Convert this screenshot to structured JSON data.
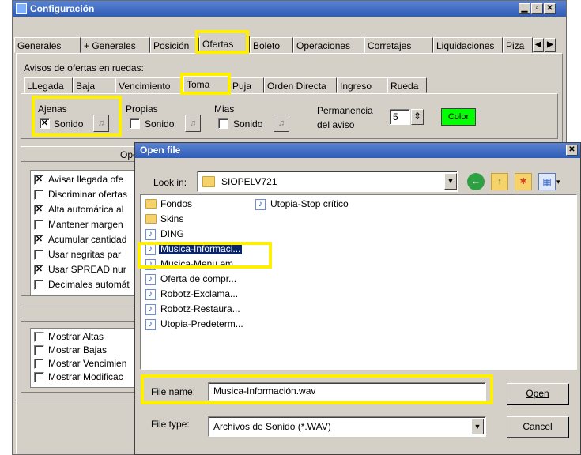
{
  "main": {
    "title": "Configuración",
    "tabs": [
      "Generales",
      "+ Generales",
      "Posición",
      "Ofertas",
      "Boleto",
      "Operaciones",
      "Corretajes",
      "Liquidaciones",
      "Piza"
    ],
    "avisos_label": "Avisos de ofertas en ruedas:",
    "subtabs": [
      "LLegada",
      "Baja",
      "Vencimiento",
      "Toma",
      "Puja",
      "Orden Directa",
      "Ingreso",
      "Rueda"
    ],
    "ajenas_label": "Ajenas",
    "propias_label": "Propias",
    "mias_label": "Mias",
    "sonido_label": "Sonido",
    "permanencia_label_1": "Permanencia",
    "permanencia_label_2": "del aviso",
    "permanencia_value": "5",
    "color_label": "Color",
    "options_header": "Opc",
    "options": [
      {
        "label": "Avisar llegada ofe",
        "checked": true
      },
      {
        "label": "Discriminar ofertas",
        "checked": false
      },
      {
        "label": "Alta automática al",
        "checked": true
      },
      {
        "label": "Mantener margen",
        "checked": false
      },
      {
        "label": "Acumular cantidad",
        "checked": true
      },
      {
        "label": "Usar negritas par",
        "checked": false
      },
      {
        "label": "Usar SPREAD nur",
        "checked": true
      },
      {
        "label": "Decimales automát",
        "checked": false
      }
    ],
    "mostrar": [
      "Mostrar Altas",
      "Mostrar Bajas",
      "Mostrar Vencimien",
      "Mostrar Modificac"
    ]
  },
  "dialog": {
    "title": "Open file",
    "look_in_label": "Look in:",
    "look_in_value": "SIOPELV721",
    "files_col1": [
      {
        "name": "Fondos",
        "type": "folder"
      },
      {
        "name": "Skins",
        "type": "folder"
      },
      {
        "name": "DING",
        "type": "sound"
      },
      {
        "name": "Musica-Informaci...",
        "type": "sound",
        "selected": true
      },
      {
        "name": "Musica-Menu em...",
        "type": "sound"
      },
      {
        "name": "Oferta de compr...",
        "type": "sound"
      },
      {
        "name": "Robotz-Exclama...",
        "type": "sound"
      },
      {
        "name": "Robotz-Restaura...",
        "type": "sound"
      },
      {
        "name": "Utopia-Predeterm...",
        "type": "sound"
      }
    ],
    "files_col2": [
      {
        "name": "Utopia-Stop crítico",
        "type": "sound"
      }
    ],
    "file_name_label": "File name:",
    "file_name_value": "Musica-Información.wav",
    "file_type_label": "File type:",
    "file_type_value": "Archivos de Sonido (*.WAV)",
    "open_label": "Open",
    "cancel_label": "Cancel"
  },
  "colors": {
    "titlebar": "#2e5cb8",
    "highlight": "#ffef00",
    "color_button": "#00ff00",
    "selection": "#0a246a"
  }
}
